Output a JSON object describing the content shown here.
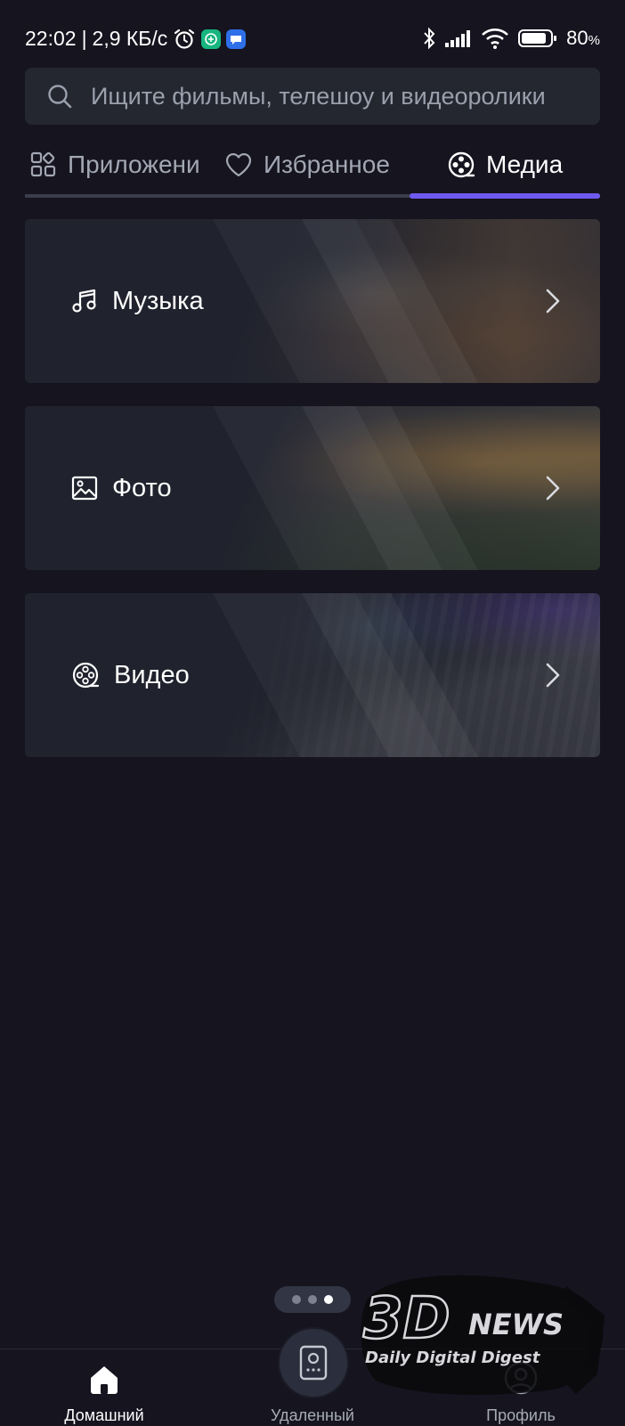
{
  "status_bar": {
    "time": "22:02",
    "separator": "|",
    "speed": "2,9 КБ/с",
    "battery": "80",
    "battery_unit": "%"
  },
  "search": {
    "placeholder": "Ищите фильмы, телешоу и видеоролики"
  },
  "tabs": [
    {
      "label": "Приложени",
      "icon": "apps-grid-icon",
      "active": false
    },
    {
      "label": "Избранное",
      "icon": "heart-icon",
      "active": false
    },
    {
      "label": "Медиа",
      "icon": "film-reel-icon",
      "active": true
    }
  ],
  "media_cards": [
    {
      "label": "Музыка",
      "icon": "music-note-icon"
    },
    {
      "label": "Фото",
      "icon": "image-icon"
    },
    {
      "label": "Видео",
      "icon": "film-reel-icon"
    }
  ],
  "pager": {
    "count": 3,
    "active_index": 2
  },
  "bottom_nav": [
    {
      "label": "Домашний",
      "icon": "home-icon",
      "active": true
    },
    {
      "label": "Удаленный",
      "icon": "remote-icon",
      "active": false
    },
    {
      "label": "Профиль",
      "icon": "profile-icon",
      "active": false
    }
  ],
  "watermark": {
    "logo_3d": "3D",
    "logo_news": "NEWS",
    "tagline": "Daily Digital Digest"
  },
  "colors": {
    "background": "#15141f",
    "card": "#20222d",
    "accent": "#6f5af0"
  }
}
